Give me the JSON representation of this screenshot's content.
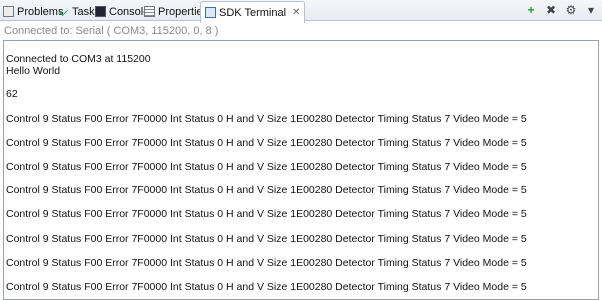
{
  "tabs": [
    {
      "label": "Problems",
      "icon": "problems-icon"
    },
    {
      "label": "Tasks",
      "icon": "tasks-icon"
    },
    {
      "label": "Console",
      "icon": "console-icon"
    },
    {
      "label": "Properties",
      "icon": "properties-icon"
    },
    {
      "label": "SDK Terminal",
      "icon": "terminal-icon",
      "close": "✕"
    }
  ],
  "toolbar": {
    "add": "+",
    "remove": "✖",
    "config": "⚙",
    "menu": "▾"
  },
  "status": "Connected to: Serial (  COM3, 115200, 0, 8 )",
  "terminal": {
    "lines": [
      "Connected to COM3 at 115200",
      "Hello World",
      "62",
      " Control 9 Status F00 Error 7F0000 Int Status 0 H and V Size 1E00280 Detector Timing Status 7 Video Mode = 5",
      "Control 9 Status F00 Error 7F0000 Int Status 0 H and V Size 1E00280 Detector Timing Status 7 Video Mode = 5",
      "Control 9 Status F00 Error 7F0000 Int Status 0 H and V Size 1E00280 Detector Timing Status 7 Video Mode = 5",
      "Control 9 Status F00 Error 7F0000 Int Status 0 H and V Size 1E00280 Detector Timing Status 7 Video Mode = 5",
      "Control 9 Status F00 Error 7F0000 Int Status 0 H and V Size 1E00280 Detector Timing Status 7 Video Mode = 5",
      "Control 9 Status F00 Error 7F0000 Int Status 0 H and V Size 1E00280 Detector Timing Status 7 Video Mode = 5",
      "Control 9 Status F00 Error 7F0000 Int Status 0 H and V Size 1E00280 Detector Timing Status 7 Video Mode = 5",
      "Control 9 Status F00 Error 7F0000 Int Status 0 H and V Size 1E00280 Detector Timing Status 7 Video Mode = 5"
    ]
  }
}
